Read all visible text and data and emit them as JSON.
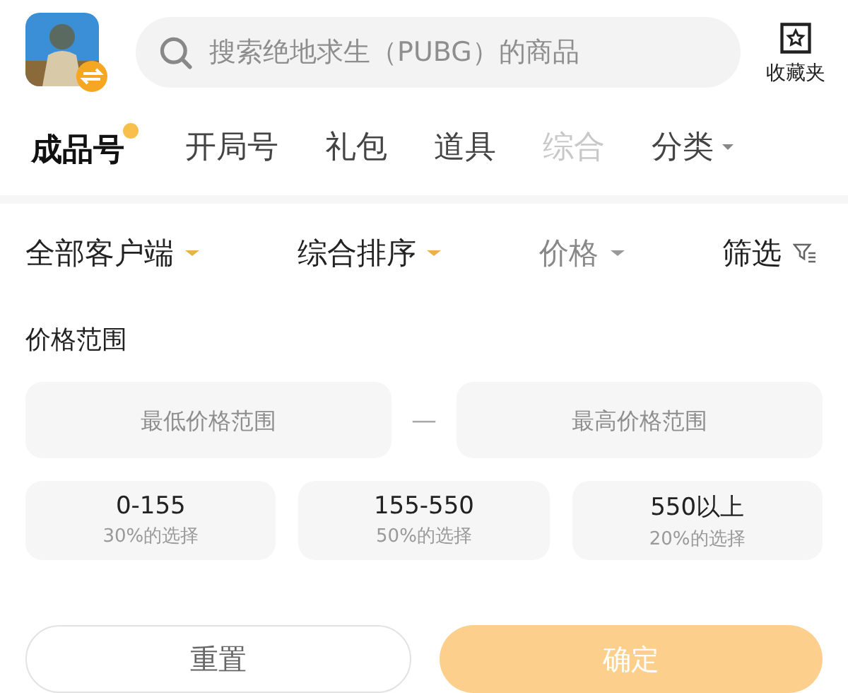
{
  "search": {
    "placeholder": "搜索绝地求生（PUBG）的商品"
  },
  "favorites": {
    "label": "收藏夹"
  },
  "tabs": [
    {
      "label": "成品号",
      "selected": true,
      "faded": false
    },
    {
      "label": "开局号",
      "selected": false,
      "faded": false
    },
    {
      "label": "礼包",
      "selected": false,
      "faded": false
    },
    {
      "label": "道具",
      "selected": false,
      "faded": false
    },
    {
      "label": "综合",
      "selected": false,
      "faded": true
    },
    {
      "label": "分类",
      "selected": false,
      "faded": false,
      "kind": "dropdown"
    }
  ],
  "filters": [
    {
      "label": "全部客户端",
      "kind": "dropdown",
      "highlighted": true,
      "expanded": false
    },
    {
      "label": "综合排序",
      "kind": "dropdown",
      "highlighted": true,
      "expanded": false
    },
    {
      "label": "价格",
      "kind": "dropdown",
      "highlighted": false,
      "expanded": true
    },
    {
      "label": "筛选",
      "kind": "filter",
      "expanded": false
    }
  ],
  "price_panel": {
    "title": "价格范围",
    "min_field": {
      "placeholder": "最低价格范围"
    },
    "separator": "—",
    "max_field": {
      "placeholder": "最高价格范围"
    },
    "options": [
      {
        "range": "0-155",
        "share": "30%的选择",
        "selected": false
      },
      {
        "range": "155-550",
        "share": "50%的选择",
        "selected": false
      },
      {
        "range": "550以上",
        "share": "20%的选择",
        "selected": false
      }
    ],
    "buttons": [
      {
        "label": "重置",
        "kind": "secondary"
      },
      {
        "label": "确定",
        "kind": "primary"
      }
    ]
  }
}
